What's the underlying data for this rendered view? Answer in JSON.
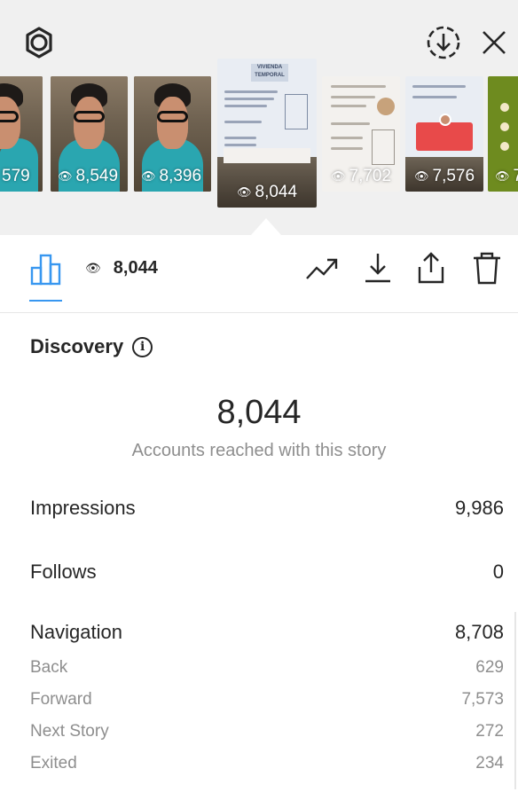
{
  "header": {
    "settings_icon": "settings-gear-icon",
    "download_icon": "download-circle-icon",
    "close_icon": "close-icon"
  },
  "story_strip": {
    "thumbnails": [
      {
        "kind": "video",
        "views": "579"
      },
      {
        "kind": "video",
        "views": "8,549"
      },
      {
        "kind": "video",
        "views": "8,396"
      },
      {
        "kind": "slide",
        "views": "8,044",
        "selected": true,
        "slide_title": "VIVIENDA TEMPORAL"
      },
      {
        "kind": "slide",
        "views": "7,702"
      },
      {
        "kind": "slide",
        "views": "7,576"
      },
      {
        "kind": "green",
        "views": "7"
      }
    ]
  },
  "toolbar": {
    "selected_views": "8,044",
    "icons": [
      "bar-chart-icon",
      "eye-icon",
      "trending-icon",
      "download-icon",
      "share-icon",
      "trash-icon"
    ],
    "accent_color": "#3897f0"
  },
  "discovery": {
    "title": "Discovery",
    "info_icon": "i",
    "accounts_reached": "8,044",
    "accounts_reached_caption": "Accounts reached with this story"
  },
  "metrics": {
    "impressions": {
      "label": "Impressions",
      "value": "9,986"
    },
    "follows": {
      "label": "Follows",
      "value": "0"
    },
    "navigation": {
      "label": "Navigation",
      "value": "8,708"
    },
    "navigation_details": [
      {
        "label": "Back",
        "value": "629"
      },
      {
        "label": "Forward",
        "value": "7,573"
      },
      {
        "label": "Next Story",
        "value": "272"
      },
      {
        "label": "Exited",
        "value": "234"
      }
    ]
  }
}
